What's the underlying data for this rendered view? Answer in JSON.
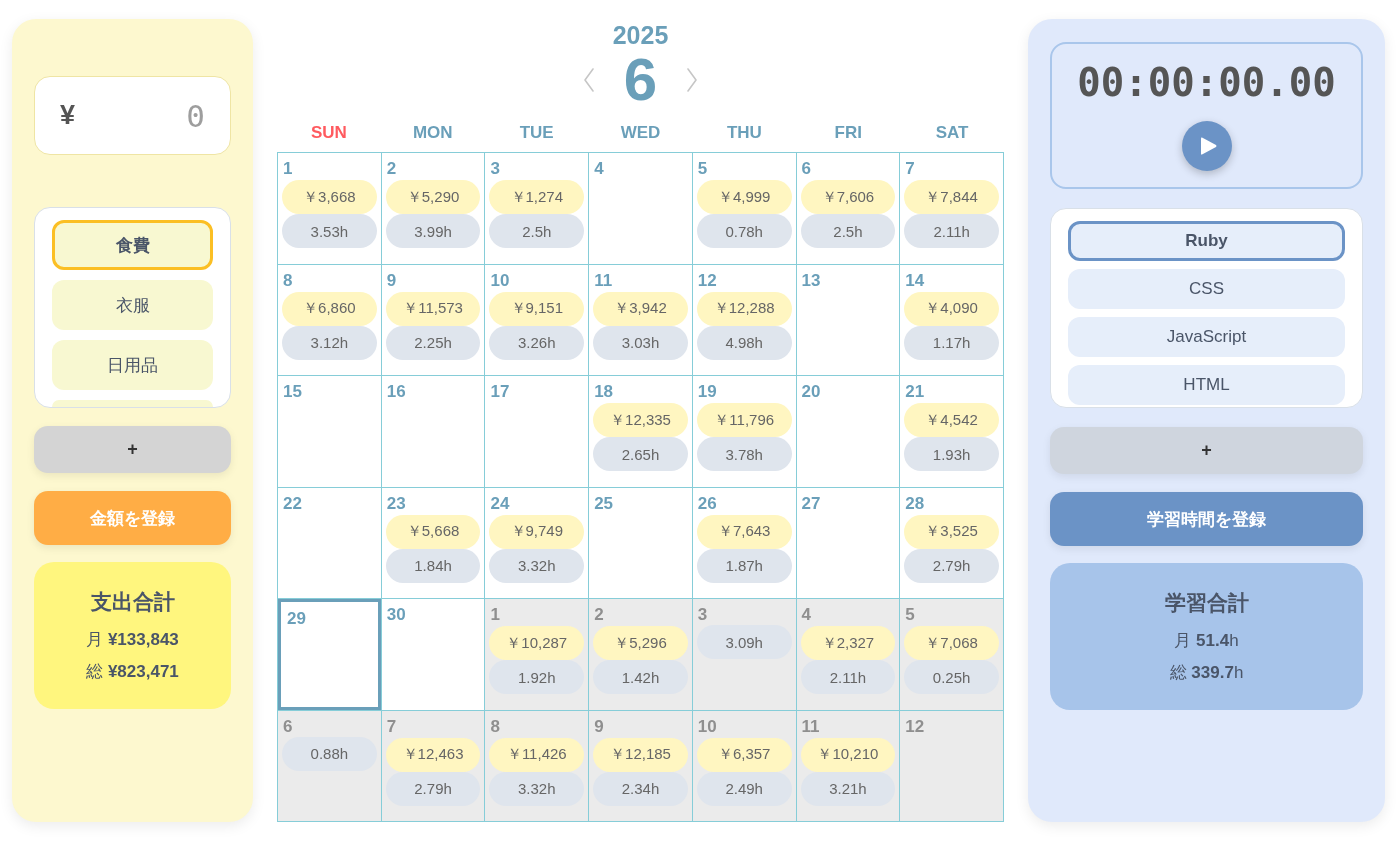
{
  "expense_panel": {
    "amount_field": {
      "currency": "¥",
      "placeholder": "0"
    },
    "categories": {
      "items": [
        {
          "label": "食費",
          "selected": true
        },
        {
          "label": "衣服",
          "selected": false
        },
        {
          "label": "日用品",
          "selected": false
        }
      ],
      "more_below": true
    },
    "add_button": "+",
    "register_button": "金額を登録",
    "summary": {
      "title": "支出合計",
      "lines": [
        "月 **¥133,843**",
        "総 **¥823,471**"
      ]
    }
  },
  "calendar": {
    "year": "2025",
    "month": "6",
    "weekdays": [
      {
        "label": "SUN",
        "kind": "sunday"
      },
      {
        "label": "MON",
        "kind": "weekday"
      },
      {
        "label": "TUE",
        "kind": "weekday"
      },
      {
        "label": "WED",
        "kind": "weekday"
      },
      {
        "label": "THU",
        "kind": "weekday"
      },
      {
        "label": "FRI",
        "kind": "weekday"
      },
      {
        "label": "SAT",
        "kind": "weekday"
      }
    ],
    "weeks": [
      {
        "days": [
          {
            "day": "1",
            "other_month": false,
            "selected": false,
            "expense": "￥3,668",
            "hours": "3.53h"
          },
          {
            "day": "2",
            "other_month": false,
            "selected": false,
            "expense": "￥5,290",
            "hours": "3.99h"
          },
          {
            "day": "3",
            "other_month": false,
            "selected": false,
            "expense": "￥1,274",
            "hours": "2.5h"
          },
          {
            "day": "4",
            "other_month": false,
            "selected": false
          },
          {
            "day": "5",
            "other_month": false,
            "selected": false,
            "expense": "￥4,999",
            "hours": "0.78h"
          },
          {
            "day": "6",
            "other_month": false,
            "selected": false,
            "expense": "￥7,606",
            "hours": "2.5h"
          },
          {
            "day": "7",
            "other_month": false,
            "selected": false,
            "expense": "￥7,844",
            "hours": "2.11h"
          }
        ]
      },
      {
        "days": [
          {
            "day": "8",
            "other_month": false,
            "selected": false,
            "expense": "￥6,860",
            "hours": "3.12h"
          },
          {
            "day": "9",
            "other_month": false,
            "selected": false,
            "expense": "￥11,573",
            "hours": "2.25h"
          },
          {
            "day": "10",
            "other_month": false,
            "selected": false,
            "expense": "￥9,151",
            "hours": "3.26h"
          },
          {
            "day": "11",
            "other_month": false,
            "selected": false,
            "expense": "￥3,942",
            "hours": "3.03h"
          },
          {
            "day": "12",
            "other_month": false,
            "selected": false,
            "expense": "￥12,288",
            "hours": "4.98h"
          },
          {
            "day": "13",
            "other_month": false,
            "selected": false
          },
          {
            "day": "14",
            "other_month": false,
            "selected": false,
            "expense": "￥4,090",
            "hours": "1.17h"
          }
        ]
      },
      {
        "days": [
          {
            "day": "15",
            "other_month": false,
            "selected": false
          },
          {
            "day": "16",
            "other_month": false,
            "selected": false
          },
          {
            "day": "17",
            "other_month": false,
            "selected": false
          },
          {
            "day": "18",
            "other_month": false,
            "selected": false,
            "expense": "￥12,335",
            "hours": "2.65h"
          },
          {
            "day": "19",
            "other_month": false,
            "selected": false,
            "expense": "￥11,796",
            "hours": "3.78h"
          },
          {
            "day": "20",
            "other_month": false,
            "selected": false
          },
          {
            "day": "21",
            "other_month": false,
            "selected": false,
            "expense": "￥4,542",
            "hours": "1.93h"
          }
        ]
      },
      {
        "days": [
          {
            "day": "22",
            "other_month": false,
            "selected": false
          },
          {
            "day": "23",
            "other_month": false,
            "selected": false,
            "expense": "￥5,668",
            "hours": "1.84h"
          },
          {
            "day": "24",
            "other_month": false,
            "selected": false,
            "expense": "￥9,749",
            "hours": "3.32h"
          },
          {
            "day": "25",
            "other_month": false,
            "selected": false
          },
          {
            "day": "26",
            "other_month": false,
            "selected": false,
            "expense": "￥7,643",
            "hours": "1.87h"
          },
          {
            "day": "27",
            "other_month": false,
            "selected": false
          },
          {
            "day": "28",
            "other_month": false,
            "selected": false,
            "expense": "￥3,525",
            "hours": "2.79h"
          }
        ]
      },
      {
        "days": [
          {
            "day": "29",
            "other_month": false,
            "selected": true
          },
          {
            "day": "30",
            "other_month": false,
            "selected": false
          },
          {
            "day": "1",
            "other_month": true,
            "selected": false,
            "expense": "￥10,287",
            "hours": "1.92h"
          },
          {
            "day": "2",
            "other_month": true,
            "selected": false,
            "expense": "￥5,296",
            "hours": "1.42h"
          },
          {
            "day": "3",
            "other_month": true,
            "selected": false,
            "hours": "3.09h"
          },
          {
            "day": "4",
            "other_month": true,
            "selected": false,
            "expense": "￥2,327",
            "hours": "2.11h"
          },
          {
            "day": "5",
            "other_month": true,
            "selected": false,
            "expense": "￥7,068",
            "hours": "0.25h"
          }
        ]
      },
      {
        "days": [
          {
            "day": "6",
            "other_month": true,
            "selected": false,
            "hours": "0.88h"
          },
          {
            "day": "7",
            "other_month": true,
            "selected": false,
            "expense": "￥12,463",
            "hours": "2.79h"
          },
          {
            "day": "8",
            "other_month": true,
            "selected": false,
            "expense": "￥11,426",
            "hours": "3.32h"
          },
          {
            "day": "9",
            "other_month": true,
            "selected": false,
            "expense": "￥12,185",
            "hours": "2.34h"
          },
          {
            "day": "10",
            "other_month": true,
            "selected": false,
            "expense": "￥6,357",
            "hours": "2.49h"
          },
          {
            "day": "11",
            "other_month": true,
            "selected": false,
            "expense": "￥10,210",
            "hours": "3.21h"
          },
          {
            "day": "12",
            "other_month": true,
            "selected": false
          }
        ]
      }
    ]
  },
  "study_panel": {
    "timer": {
      "display": "00:00:00.00",
      "running": false
    },
    "subjects": {
      "items": [
        {
          "label": "Ruby",
          "selected": true
        },
        {
          "label": "CSS",
          "selected": false
        },
        {
          "label": "JavaScript",
          "selected": false
        },
        {
          "label": "HTML",
          "selected": false
        }
      ]
    },
    "add_button": "+",
    "register_button": "学習時間を登録",
    "summary": {
      "title": "学習合計",
      "lines": [
        "月 **51.4**h",
        "総 **339.7**h"
      ]
    }
  }
}
